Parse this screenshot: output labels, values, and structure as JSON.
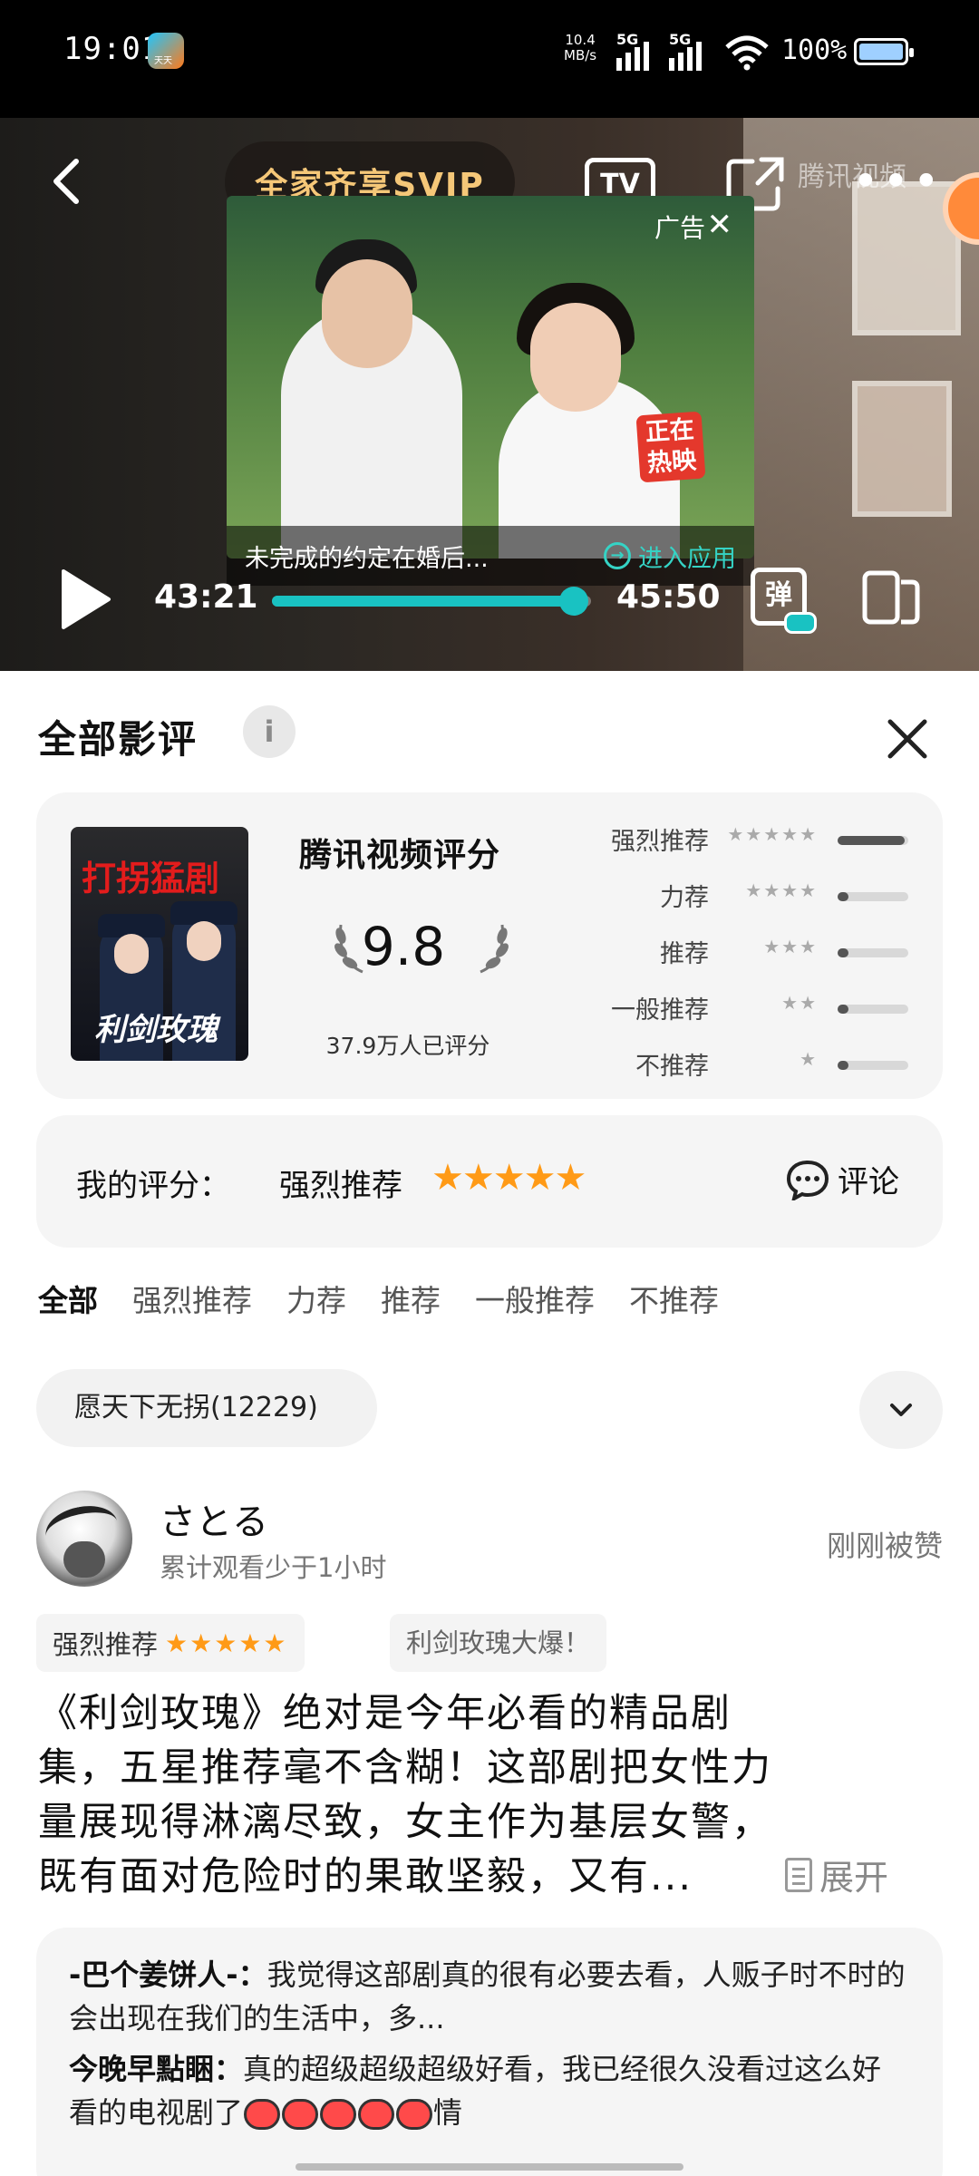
{
  "status_bar": {
    "time": "19:01",
    "app_badge": "天天",
    "net_speed_value": "10.4",
    "net_speed_unit": "MB/s",
    "sim1": "5G",
    "sim2": "5G",
    "battery": "100%"
  },
  "player": {
    "svip_label": "全家齐享SVIP",
    "tv_label": "TV",
    "watermark": "腾讯视频",
    "ad_label": "广告",
    "ad_close": "✕",
    "hot_badge_line1": "正在",
    "hot_badge_line2": "热映",
    "ad_caption": "未完成的约定在婚后...",
    "ad_cta": "进入应用",
    "current_time": "43:21",
    "total_time": "45:50",
    "progress": 0.946,
    "danmu_label": "弹"
  },
  "sheet": {
    "title": "全部影评",
    "info": "i",
    "rating": {
      "poster_title_top": "打拐猛剧",
      "poster_title_bottom": "利剑玫瑰",
      "title": "腾讯视频评分",
      "score": "9.8",
      "count": "37.9万人已评分",
      "distribution": [
        {
          "label": "强烈推荐",
          "stars": "★★★★★",
          "fraction": 0.95
        },
        {
          "label": "力荐",
          "stars": "★★★★",
          "fraction": 0.03
        },
        {
          "label": "推荐",
          "stars": "★★★",
          "fraction": 0.01
        },
        {
          "label": "一般推荐",
          "stars": "★★",
          "fraction": 0.005
        },
        {
          "label": "不推荐",
          "stars": "★",
          "fraction": 0.005
        }
      ]
    },
    "my_rating": {
      "label": "我的评分：",
      "value": "强烈推荐",
      "stars": "★★★★★",
      "comment_label": "评论"
    },
    "filters": [
      "全部",
      "强烈推荐",
      "力荐",
      "推荐",
      "一般推荐",
      "不推荐"
    ],
    "tag_chip": "愿天下无拐(12229)",
    "review": {
      "username": "さとる",
      "meta": "累计观看少于1小时",
      "liked": "刚刚被赞",
      "rating_tag": "强烈推荐",
      "rating_stars": "★★★★★",
      "topic_tag": "利剑玫瑰大爆！",
      "body": "《利剑玫瑰》绝对是今年必看的精品剧集，五星推荐毫不含糊！这部剧把女性力量展现得淋漓尽致，女主作为基层女警，既有面对危险时的果敢坚毅，又有...",
      "expand": "展开"
    },
    "replies": [
      {
        "user": "-巴个姜饼人-",
        "text": "我觉得这部剧真的很有必要去看，人贩子时不时的会出现在我们的生活中，多..."
      },
      {
        "user": "今晚早點睏",
        "text": "真的超级超级超级好看，我已经很久没看过这么好看的电视剧了",
        "tail": "情"
      }
    ]
  }
}
